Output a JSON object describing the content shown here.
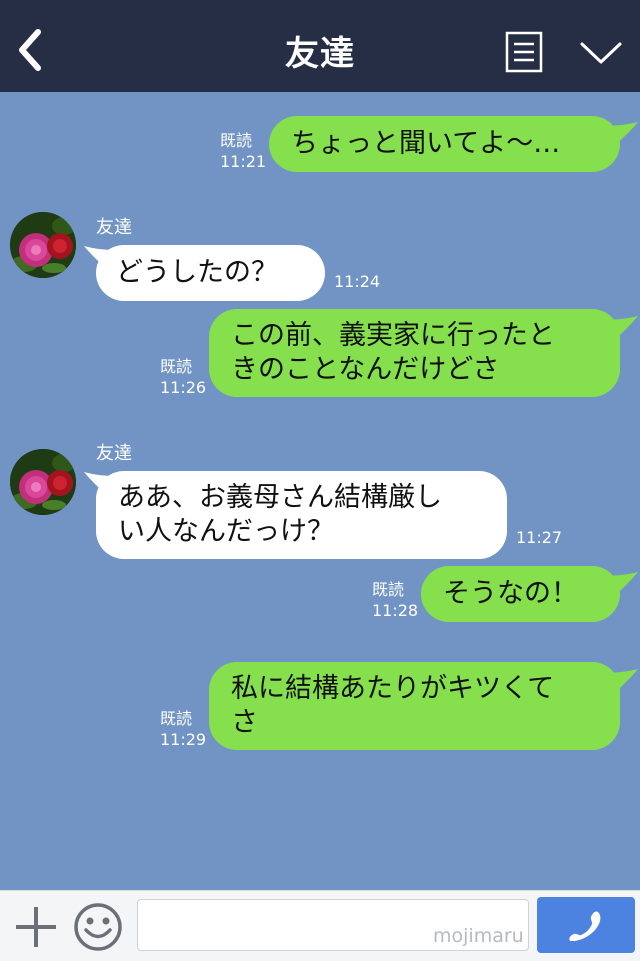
{
  "header": {
    "title": "友達",
    "back_icon": "chevron-left-icon",
    "menu_icon": "list-icon",
    "collapse_icon": "chevron-down-icon"
  },
  "messages": [
    {
      "id": 0,
      "direction": "out",
      "text": "ちょっと聞いてよ〜…",
      "read_label": "既読",
      "time": "11:21"
    },
    {
      "id": 1,
      "direction": "in",
      "sender": "友達",
      "text": "どうしたの？",
      "time": "11:24"
    },
    {
      "id": 2,
      "direction": "out",
      "lines": [
        "この前、義実家に行ったと",
        "きのことなんだけどさ"
      ],
      "read_label": "既読",
      "time": "11:26"
    },
    {
      "id": 3,
      "direction": "in",
      "sender": "友達",
      "lines": [
        "ああ、お義母さん結構厳し",
        "い人なんだっけ？"
      ],
      "time": "11:27"
    },
    {
      "id": 4,
      "direction": "out",
      "text": "そうなの！",
      "read_label": "既読",
      "time": "11:28"
    },
    {
      "id": 5,
      "direction": "out",
      "lines": [
        "私に結構あたりがキツくて",
        "さ"
      ],
      "read_label": "既読",
      "time": "11:29"
    }
  ],
  "input_bar": {
    "placeholder": "",
    "watermark": "mojimaru",
    "plus_icon": "plus-icon",
    "emoji_icon": "smiley-icon",
    "call_icon": "phone-icon"
  },
  "colors": {
    "header_bg": "#252e45",
    "chat_bg": "#7194c4",
    "outgoing_bubble": "#86e04d",
    "incoming_bubble": "#ffffff",
    "call_button": "#4c82e0"
  }
}
